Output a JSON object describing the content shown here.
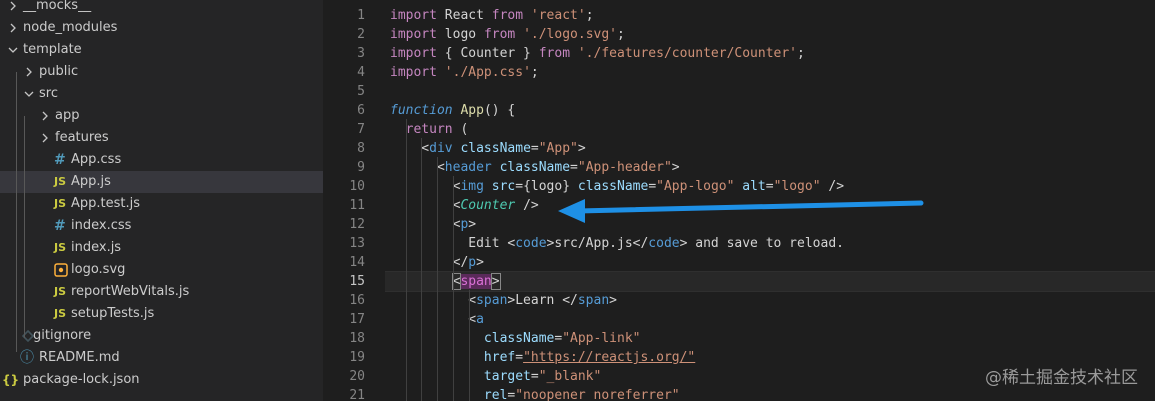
{
  "explorer": {
    "items": [
      {
        "label": "__mocks__",
        "kind": "folder",
        "expanded": false
      },
      {
        "label": "node_modules",
        "kind": "folder",
        "expanded": false
      },
      {
        "label": "template",
        "kind": "folder",
        "expanded": true
      },
      {
        "label": "public",
        "kind": "folder",
        "expanded": false
      },
      {
        "label": "src",
        "kind": "folder",
        "expanded": true
      },
      {
        "label": "app",
        "kind": "folder",
        "expanded": false
      },
      {
        "label": "features",
        "kind": "folder",
        "expanded": false
      },
      {
        "label": "App.css",
        "kind": "css",
        "icon_text": "#"
      },
      {
        "label": "App.js",
        "kind": "js",
        "icon_text": "JS",
        "selected": true
      },
      {
        "label": "App.test.js",
        "kind": "js",
        "icon_text": "JS"
      },
      {
        "label": "index.css",
        "kind": "css",
        "icon_text": "#"
      },
      {
        "label": "index.js",
        "kind": "js",
        "icon_text": "JS"
      },
      {
        "label": "logo.svg",
        "kind": "svg"
      },
      {
        "label": "reportWebVitals.js",
        "kind": "js",
        "icon_text": "JS"
      },
      {
        "label": "setupTests.js",
        "kind": "js",
        "icon_text": "JS"
      },
      {
        "label": "gitignore",
        "kind": "gitignore"
      },
      {
        "label": "README.md",
        "kind": "info",
        "icon_text": "ⓘ"
      },
      {
        "label": "package-lock.json",
        "kind": "json",
        "icon_text": "{}"
      }
    ]
  },
  "editor": {
    "active_line": 15,
    "lines": [
      {
        "num": "1",
        "tokens": [
          [
            "kw",
            "import"
          ],
          [
            "p",
            " React "
          ],
          [
            "kw",
            "from"
          ],
          [
            "p",
            " "
          ],
          [
            "str",
            "'react'"
          ],
          [
            "p",
            ";"
          ]
        ]
      },
      {
        "num": "2",
        "tokens": [
          [
            "kw",
            "import"
          ],
          [
            "p",
            " logo "
          ],
          [
            "kw",
            "from"
          ],
          [
            "p",
            " "
          ],
          [
            "str",
            "'./logo.svg'"
          ],
          [
            "p",
            ";"
          ]
        ]
      },
      {
        "num": "3",
        "tokens": [
          [
            "kw",
            "import"
          ],
          [
            "p",
            " { Counter } "
          ],
          [
            "kw",
            "from"
          ],
          [
            "p",
            " "
          ],
          [
            "str",
            "'./features/counter/Counter'"
          ],
          [
            "p",
            ";"
          ]
        ]
      },
      {
        "num": "4",
        "tokens": [
          [
            "kw",
            "import"
          ],
          [
            "p",
            " "
          ],
          [
            "str",
            "'./App.css'"
          ],
          [
            "p",
            ";"
          ]
        ]
      },
      {
        "num": "5",
        "tokens": []
      },
      {
        "num": "6",
        "tokens": [
          [
            "fnkw",
            "function"
          ],
          [
            "p",
            " "
          ],
          [
            "fn",
            "App"
          ],
          [
            "p",
            "() {"
          ]
        ]
      },
      {
        "num": "7",
        "tokens": [
          [
            "p",
            "  "
          ],
          [
            "kw",
            "return"
          ],
          [
            "p",
            " ("
          ]
        ]
      },
      {
        "num": "8",
        "tokens": [
          [
            "p",
            "    <"
          ],
          [
            "tag",
            "div"
          ],
          [
            "p",
            " "
          ],
          [
            "attr",
            "className"
          ],
          [
            "p",
            "="
          ],
          [
            "str",
            "\"App\""
          ],
          [
            "p",
            ">"
          ]
        ]
      },
      {
        "num": "9",
        "tokens": [
          [
            "p",
            "      <"
          ],
          [
            "tag",
            "header"
          ],
          [
            "p",
            " "
          ],
          [
            "attr",
            "className"
          ],
          [
            "p",
            "="
          ],
          [
            "str",
            "\"App-header\""
          ],
          [
            "p",
            ">"
          ]
        ]
      },
      {
        "num": "10",
        "tokens": [
          [
            "p",
            "        <"
          ],
          [
            "tag",
            "img"
          ],
          [
            "p",
            " "
          ],
          [
            "attr",
            "src"
          ],
          [
            "p",
            "={logo} "
          ],
          [
            "attr",
            "className"
          ],
          [
            "p",
            "="
          ],
          [
            "str",
            "\"App-logo\""
          ],
          [
            "p",
            " "
          ],
          [
            "attr",
            "alt"
          ],
          [
            "p",
            "="
          ],
          [
            "str",
            "\"logo\""
          ],
          [
            "p",
            " />"
          ]
        ]
      },
      {
        "num": "11",
        "tokens": [
          [
            "p",
            "        <"
          ],
          [
            "comp",
            "Counter"
          ],
          [
            "p",
            " />"
          ]
        ]
      },
      {
        "num": "12",
        "tokens": [
          [
            "p",
            "        <"
          ],
          [
            "tag",
            "p"
          ],
          [
            "p",
            ">"
          ]
        ]
      },
      {
        "num": "13",
        "tokens": [
          [
            "p",
            "          Edit <"
          ],
          [
            "tag",
            "code"
          ],
          [
            "p",
            ">src/App.js</"
          ],
          [
            "tag",
            "code"
          ],
          [
            "p",
            "> and save to reload."
          ]
        ]
      },
      {
        "num": "14",
        "tokens": [
          [
            "p",
            "        </"
          ],
          [
            "tag",
            "p"
          ],
          [
            "p",
            ">"
          ]
        ]
      },
      {
        "num": "15",
        "tokens": [
          [
            "p",
            "        "
          ],
          [
            "box",
            "<"
          ],
          [
            "tag",
            "span"
          ],
          [
            "box",
            ">"
          ]
        ]
      },
      {
        "num": "16",
        "tokens": [
          [
            "p",
            "          <"
          ],
          [
            "tag",
            "span"
          ],
          [
            "p",
            ">Learn </"
          ],
          [
            "tag",
            "span"
          ],
          [
            "p",
            ">"
          ]
        ]
      },
      {
        "num": "17",
        "tokens": [
          [
            "p",
            "          <"
          ],
          [
            "tag",
            "a"
          ]
        ]
      },
      {
        "num": "18",
        "tokens": [
          [
            "p",
            "            "
          ],
          [
            "attr",
            "className"
          ],
          [
            "p",
            "="
          ],
          [
            "str",
            "\"App-link\""
          ]
        ]
      },
      {
        "num": "19",
        "tokens": [
          [
            "p",
            "            "
          ],
          [
            "attr",
            "href"
          ],
          [
            "p",
            "="
          ],
          [
            "strul",
            "\"https://reactjs.org/\""
          ]
        ]
      },
      {
        "num": "20",
        "tokens": [
          [
            "p",
            "            "
          ],
          [
            "attr",
            "target"
          ],
          [
            "p",
            "="
          ],
          [
            "str",
            "\"_blank\""
          ]
        ]
      },
      {
        "num": "21",
        "tokens": [
          [
            "p",
            "            "
          ],
          [
            "attr",
            "rel"
          ],
          [
            "p",
            "="
          ],
          [
            "str",
            "\"noopener noreferrer\""
          ]
        ]
      }
    ]
  },
  "watermark": {
    "text": "@稀土掘金技术社区"
  },
  "colors": {
    "keyword": "#c586c0",
    "function_keyword": "#569cd6",
    "function_name": "#dcdcaa",
    "string": "#ce9178",
    "tag": "#569cd6",
    "attribute": "#9cdcfe",
    "component": "#4ec9b0",
    "punctuation": "#d4d4d4",
    "bracket_pink": "#da70d6",
    "js_icon": "#cbcb41",
    "css_icon": "#519aba",
    "svg_icon": "#ffb13b",
    "arrow": "#1e90e6"
  },
  "annotation": {
    "arrow_target_line": 11
  }
}
